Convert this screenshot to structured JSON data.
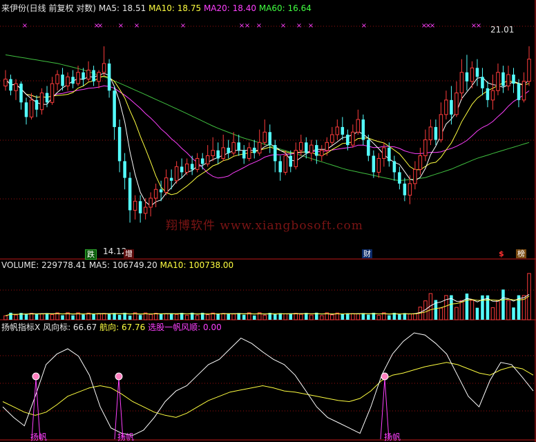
{
  "main": {
    "title": "来伊份(日线 前复权 对数)",
    "ma5": "MA5: 18.51",
    "ma10": "MA10: 18.75",
    "ma20": "MA20: 18.40",
    "ma60": "MA60: 16.64",
    "high_label": "21.01",
    "low_label": "14.12"
  },
  "volume": {
    "vol": "VOLUME: 229778.41",
    "ma5": "MA5: 106749.20",
    "ma10": "MA10: 100738.00"
  },
  "indicator": {
    "name": "扬帆指标X",
    "wind": "风向标: 66.67",
    "course": "航向: 67.76",
    "pick": "选股一帆风顺: 0.00",
    "signal": "扬帆"
  },
  "badges": [
    "跌",
    "增",
    "财",
    "$",
    "榜"
  ],
  "watermark": "翔博软件 www.xiangbosoft.com",
  "colors": {
    "up": "#ff3c3c",
    "down": "#54ffff",
    "ma5": "#ffffff",
    "ma10": "#ffff40",
    "ma20": "#ff40ff",
    "ma60": "#40c040",
    "grid": "#a01010"
  },
  "chart_data": {
    "type": "candlestick",
    "candles": [
      [
        19.2,
        19.5,
        19.9,
        19.0
      ],
      [
        19.5,
        19.0,
        19.7,
        18.8
      ],
      [
        19.0,
        19.3,
        19.5,
        18.6
      ],
      [
        19.3,
        18.5,
        19.4,
        18.2
      ],
      [
        18.5,
        17.9,
        18.7,
        17.6
      ],
      [
        17.9,
        18.6,
        18.9,
        17.8
      ],
      [
        18.6,
        18.2,
        18.8,
        17.9
      ],
      [
        18.2,
        18.9,
        19.1,
        18.0
      ],
      [
        18.9,
        18.5,
        19.2,
        18.3
      ],
      [
        18.5,
        19.3,
        19.6,
        18.4
      ],
      [
        19.3,
        19.7,
        19.9,
        19.0
      ],
      [
        19.7,
        19.2,
        20.0,
        19.0
      ],
      [
        19.2,
        19.6,
        19.8,
        19.0
      ],
      [
        19.6,
        19.3,
        19.9,
        19.1
      ],
      [
        19.3,
        19.8,
        20.1,
        19.2
      ],
      [
        19.8,
        19.5,
        20.0,
        19.2
      ],
      [
        19.5,
        19.9,
        20.3,
        19.4
      ],
      [
        19.9,
        19.4,
        20.1,
        19.2
      ],
      [
        19.4,
        19.8,
        19.9,
        19.1
      ],
      [
        19.8,
        20.2,
        21.0,
        19.6
      ],
      [
        20.2,
        19.0,
        20.4,
        18.7
      ],
      [
        19.0,
        17.5,
        19.2,
        17.0
      ],
      [
        17.5,
        16.2,
        17.8,
        15.8
      ],
      [
        16.2,
        15.6,
        16.5,
        15.2
      ],
      [
        15.6,
        14.5,
        15.8,
        14.1
      ],
      [
        14.5,
        14.8,
        15.0,
        14.2
      ],
      [
        14.8,
        14.4,
        15.0,
        14.1
      ],
      [
        14.4,
        14.6,
        14.9,
        14.2
      ],
      [
        14.6,
        14.9,
        15.1,
        14.3
      ],
      [
        14.9,
        15.2,
        15.4,
        14.6
      ],
      [
        15.2,
        15.1,
        15.5,
        14.8
      ],
      [
        15.1,
        15.6,
        15.9,
        15.0
      ],
      [
        15.6,
        15.5,
        15.9,
        15.2
      ],
      [
        15.5,
        16.0,
        16.2,
        15.4
      ],
      [
        16.0,
        15.8,
        16.3,
        15.6
      ],
      [
        15.8,
        16.1,
        16.3,
        15.7
      ],
      [
        16.1,
        15.9,
        16.4,
        15.7
      ],
      [
        15.9,
        16.3,
        16.5,
        15.8
      ],
      [
        16.3,
        16.1,
        16.5,
        15.9
      ],
      [
        16.1,
        16.4,
        16.8,
        16.0
      ],
      [
        16.4,
        16.6,
        17.1,
        16.2
      ],
      [
        16.6,
        16.3,
        16.9,
        16.1
      ],
      [
        16.3,
        16.7,
        17.2,
        16.2
      ],
      [
        16.7,
        16.5,
        17.0,
        16.3
      ],
      [
        16.5,
        16.9,
        17.3,
        16.4
      ],
      [
        16.9,
        16.6,
        17.2,
        16.4
      ],
      [
        16.6,
        16.3,
        16.8,
        16.1
      ],
      [
        16.3,
        16.7,
        16.9,
        16.2
      ],
      [
        16.7,
        16.5,
        17.0,
        16.3
      ],
      [
        16.5,
        16.9,
        17.4,
        16.4
      ],
      [
        16.9,
        17.3,
        17.8,
        16.8
      ],
      [
        17.3,
        16.8,
        17.6,
        16.5
      ],
      [
        16.8,
        16.2,
        17.0,
        15.8
      ],
      [
        16.2,
        15.8,
        16.4,
        15.5
      ],
      [
        15.8,
        16.4,
        16.6,
        15.7
      ],
      [
        16.4,
        16.0,
        16.6,
        15.8
      ],
      [
        16.0,
        16.6,
        16.9,
        15.9
      ],
      [
        16.6,
        16.9,
        17.2,
        16.4
      ],
      [
        16.9,
        16.5,
        17.1,
        16.3
      ],
      [
        16.5,
        16.8,
        17.0,
        16.2
      ],
      [
        16.8,
        16.4,
        17.0,
        16.1
      ],
      [
        16.4,
        16.6,
        16.8,
        16.2
      ],
      [
        16.6,
        16.9,
        17.1,
        16.4
      ],
      [
        16.9,
        17.2,
        17.5,
        16.8
      ],
      [
        17.2,
        17.5,
        17.8,
        17.0
      ],
      [
        17.5,
        17.2,
        17.9,
        17.0
      ],
      [
        17.2,
        16.8,
        17.4,
        16.6
      ],
      [
        16.8,
        17.3,
        17.6,
        16.7
      ],
      [
        17.3,
        17.8,
        18.2,
        17.2
      ],
      [
        17.8,
        17.0,
        18.0,
        16.8
      ],
      [
        17.0,
        16.4,
        17.2,
        16.2
      ],
      [
        16.4,
        15.8,
        16.6,
        15.6
      ],
      [
        15.8,
        16.3,
        16.5,
        15.6
      ],
      [
        16.3,
        16.7,
        16.9,
        16.0
      ],
      [
        16.7,
        16.2,
        16.9,
        16.0
      ],
      [
        16.2,
        15.8,
        16.4,
        15.5
      ],
      [
        15.8,
        15.4,
        16.0,
        15.2
      ],
      [
        15.4,
        15.0,
        15.6,
        14.8
      ],
      [
        15.0,
        15.4,
        15.7,
        14.7
      ],
      [
        15.4,
        15.9,
        16.2,
        15.2
      ],
      [
        15.9,
        16.4,
        16.7,
        15.7
      ],
      [
        16.4,
        17.0,
        17.4,
        16.2
      ],
      [
        17.0,
        17.5,
        17.8,
        16.8
      ],
      [
        17.5,
        17.0,
        17.8,
        16.8
      ],
      [
        17.0,
        18.0,
        18.5,
        16.9
      ],
      [
        18.0,
        18.6,
        19.0,
        17.8
      ],
      [
        18.6,
        18.0,
        19.2,
        17.6
      ],
      [
        18.0,
        18.9,
        19.4,
        17.9
      ],
      [
        18.9,
        19.8,
        20.4,
        18.6
      ],
      [
        19.8,
        19.4,
        20.6,
        19.0
      ],
      [
        19.4,
        20.0,
        20.3,
        19.1
      ],
      [
        20.0,
        19.6,
        20.4,
        19.2
      ],
      [
        19.6,
        19.1,
        20.0,
        18.8
      ],
      [
        19.1,
        18.6,
        19.4,
        18.3
      ],
      [
        18.6,
        19.0,
        19.7,
        18.2
      ],
      [
        19.0,
        19.8,
        20.2,
        18.8
      ],
      [
        19.8,
        19.2,
        20.1,
        18.9
      ],
      [
        19.2,
        19.7,
        20.1,
        19.0
      ],
      [
        19.7,
        19.3,
        20.0,
        18.9
      ],
      [
        19.3,
        18.6,
        19.5,
        18.3
      ],
      [
        18.6,
        19.4,
        19.8,
        18.5
      ],
      [
        19.4,
        20.4,
        21.0,
        19.2
      ]
    ]
  }
}
